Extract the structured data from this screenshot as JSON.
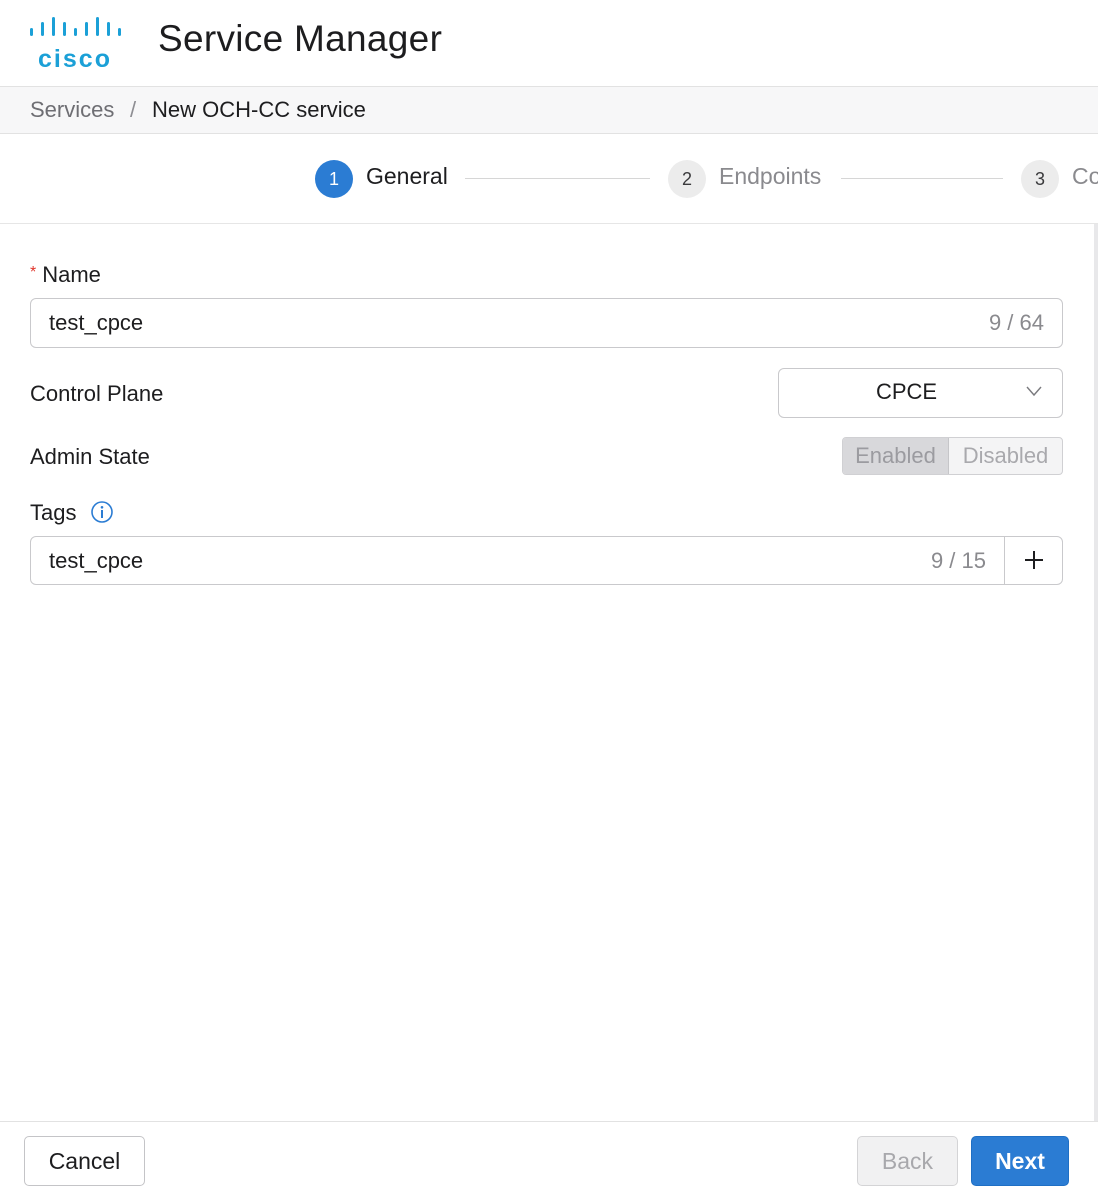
{
  "header": {
    "brand": "cisco",
    "title": "Service Manager"
  },
  "breadcrumb": {
    "parent": "Services",
    "separator": "/",
    "current": "New OCH-CC service"
  },
  "stepper": {
    "steps": [
      {
        "number": "1",
        "label": "General",
        "active": true
      },
      {
        "number": "2",
        "label": "Endpoints",
        "active": false
      },
      {
        "number": "3",
        "label": "Co",
        "active": false
      }
    ]
  },
  "form": {
    "name": {
      "required_mark": "*",
      "label": "Name",
      "value": "test_cpce",
      "counter": "9 / 64"
    },
    "control_plane": {
      "label": "Control Plane",
      "value": "CPCE"
    },
    "admin_state": {
      "label": "Admin State",
      "options": [
        "Enabled",
        "Disabled"
      ],
      "selected": "Enabled"
    },
    "tags": {
      "label": "Tags",
      "value": "test_cpce",
      "counter": "9 / 15"
    }
  },
  "footer": {
    "cancel_label": "Cancel",
    "back_label": "Back",
    "next_label": "Next"
  },
  "colors": {
    "accent": "#2b7cd3",
    "brand": "#1ba0d7",
    "required": "#e0352b"
  }
}
